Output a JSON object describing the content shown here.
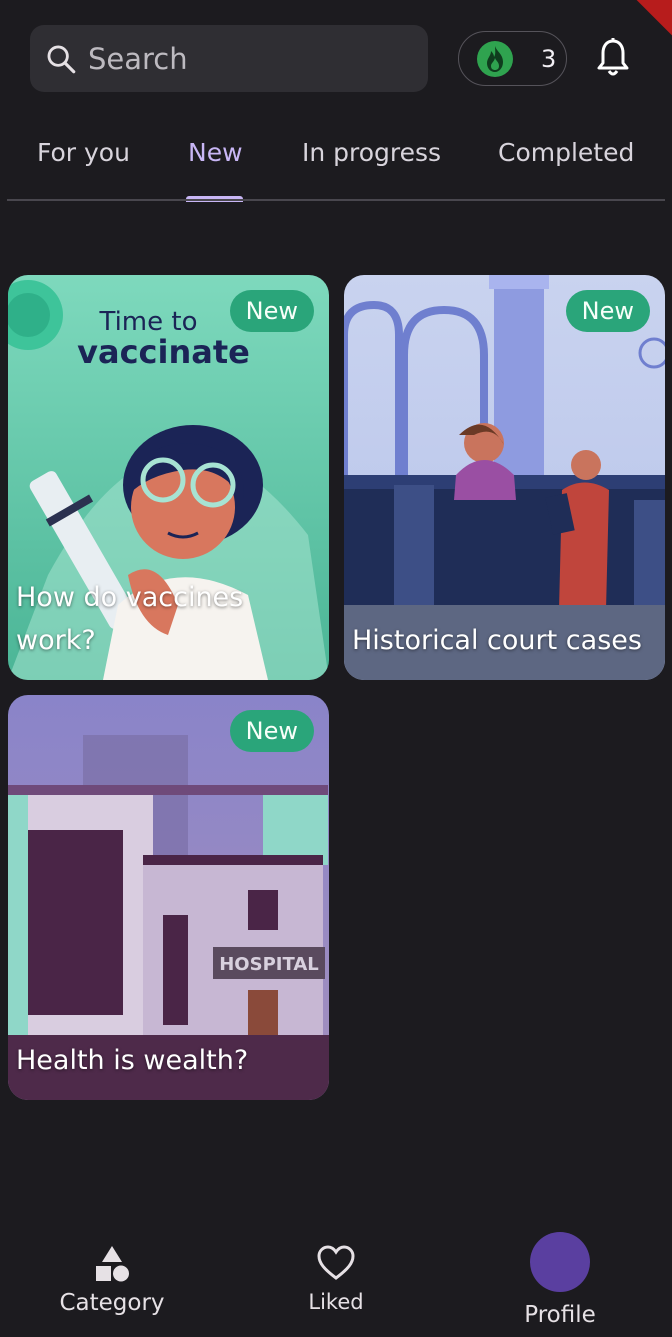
{
  "search": {
    "placeholder": "Search",
    "icon": "search-icon"
  },
  "streak": {
    "count": "3",
    "icon": "flame-icon",
    "color": "#2fa34f"
  },
  "notifications": {
    "icon": "bell-icon"
  },
  "tabs": [
    {
      "label": "For you",
      "active": false
    },
    {
      "label": "New",
      "active": true
    },
    {
      "label": "In progress",
      "active": false
    },
    {
      "label": "Completed",
      "active": false
    }
  ],
  "cards": [
    {
      "title": "How do vaccines work?",
      "badge": "New",
      "poster_line1": "Time to",
      "poster_line2": "vaccinate"
    },
    {
      "title": "Historical court cases",
      "badge": "New"
    },
    {
      "title": "Health is wealth?",
      "badge": "New",
      "sign": "HOSPITAL"
    }
  ],
  "bottom_nav": [
    {
      "label": "Category",
      "icon": "shapes-icon"
    },
    {
      "label": "Liked",
      "icon": "heart-icon"
    },
    {
      "label": "Profile",
      "icon": "avatar"
    }
  ],
  "colors": {
    "accent": "#c8b6f5",
    "badge": "#2aa57a",
    "background": "#1c1b1f",
    "avatar": "#5a3fa0"
  }
}
